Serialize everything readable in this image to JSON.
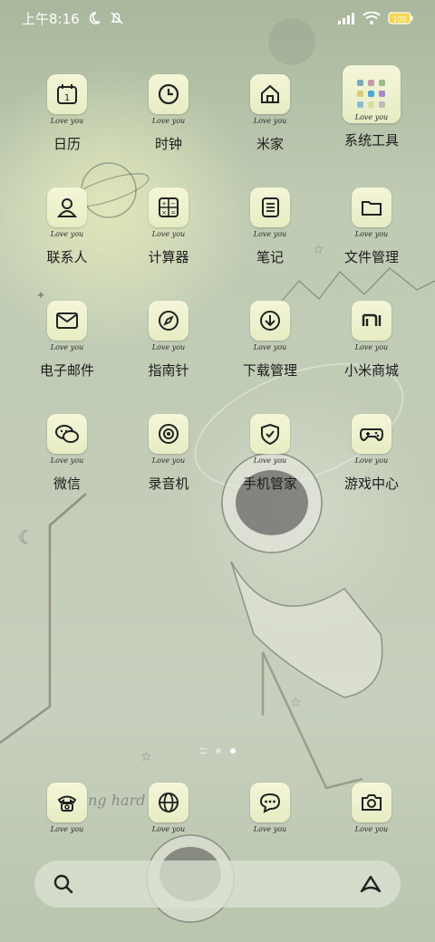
{
  "status": {
    "time": "上午8:16",
    "battery": "100"
  },
  "apps": [
    {
      "name": "日历",
      "tag": "Love you",
      "icon": "calendar-icon"
    },
    {
      "name": "时钟",
      "tag": "Love you",
      "icon": "clock-icon"
    },
    {
      "name": "米家",
      "tag": "Love you",
      "icon": "home-icon"
    },
    {
      "name": "系统工具",
      "tag": "Love you",
      "icon": "tools-folder-icon"
    },
    {
      "name": "联系人",
      "tag": "Love you",
      "icon": "contacts-icon"
    },
    {
      "name": "计算器",
      "tag": "Love you",
      "icon": "calculator-icon"
    },
    {
      "name": "笔记",
      "tag": "Love you",
      "icon": "notes-icon"
    },
    {
      "name": "文件管理",
      "tag": "Love you",
      "icon": "folder-icon"
    },
    {
      "name": "电子邮件",
      "tag": "Love you",
      "icon": "mail-icon"
    },
    {
      "name": "指南针",
      "tag": "Love you",
      "icon": "compass-icon"
    },
    {
      "name": "下载管理",
      "tag": "Love you",
      "icon": "download-icon"
    },
    {
      "name": "小米商城",
      "tag": "Love you",
      "icon": "mi-store-icon"
    },
    {
      "name": "微信",
      "tag": "Love you",
      "icon": "wechat-icon"
    },
    {
      "name": "录音机",
      "tag": "Love you",
      "icon": "recorder-icon"
    },
    {
      "name": "手机管家",
      "tag": "Love you",
      "icon": "shield-icon"
    },
    {
      "name": "游戏中心",
      "tag": "Love you",
      "icon": "gamepad-icon"
    }
  ],
  "dock": [
    {
      "tag": "Love you",
      "icon": "phone-icon"
    },
    {
      "tag": "Love you",
      "icon": "browser-icon"
    },
    {
      "tag": "Love you",
      "icon": "messages-icon"
    },
    {
      "tag": "Love you",
      "icon": "camera-icon"
    }
  ],
  "search": {
    "left_icon": "search-icon",
    "right_icon": "assistant-icon"
  },
  "wallpaper_text": "ing hard  ine"
}
